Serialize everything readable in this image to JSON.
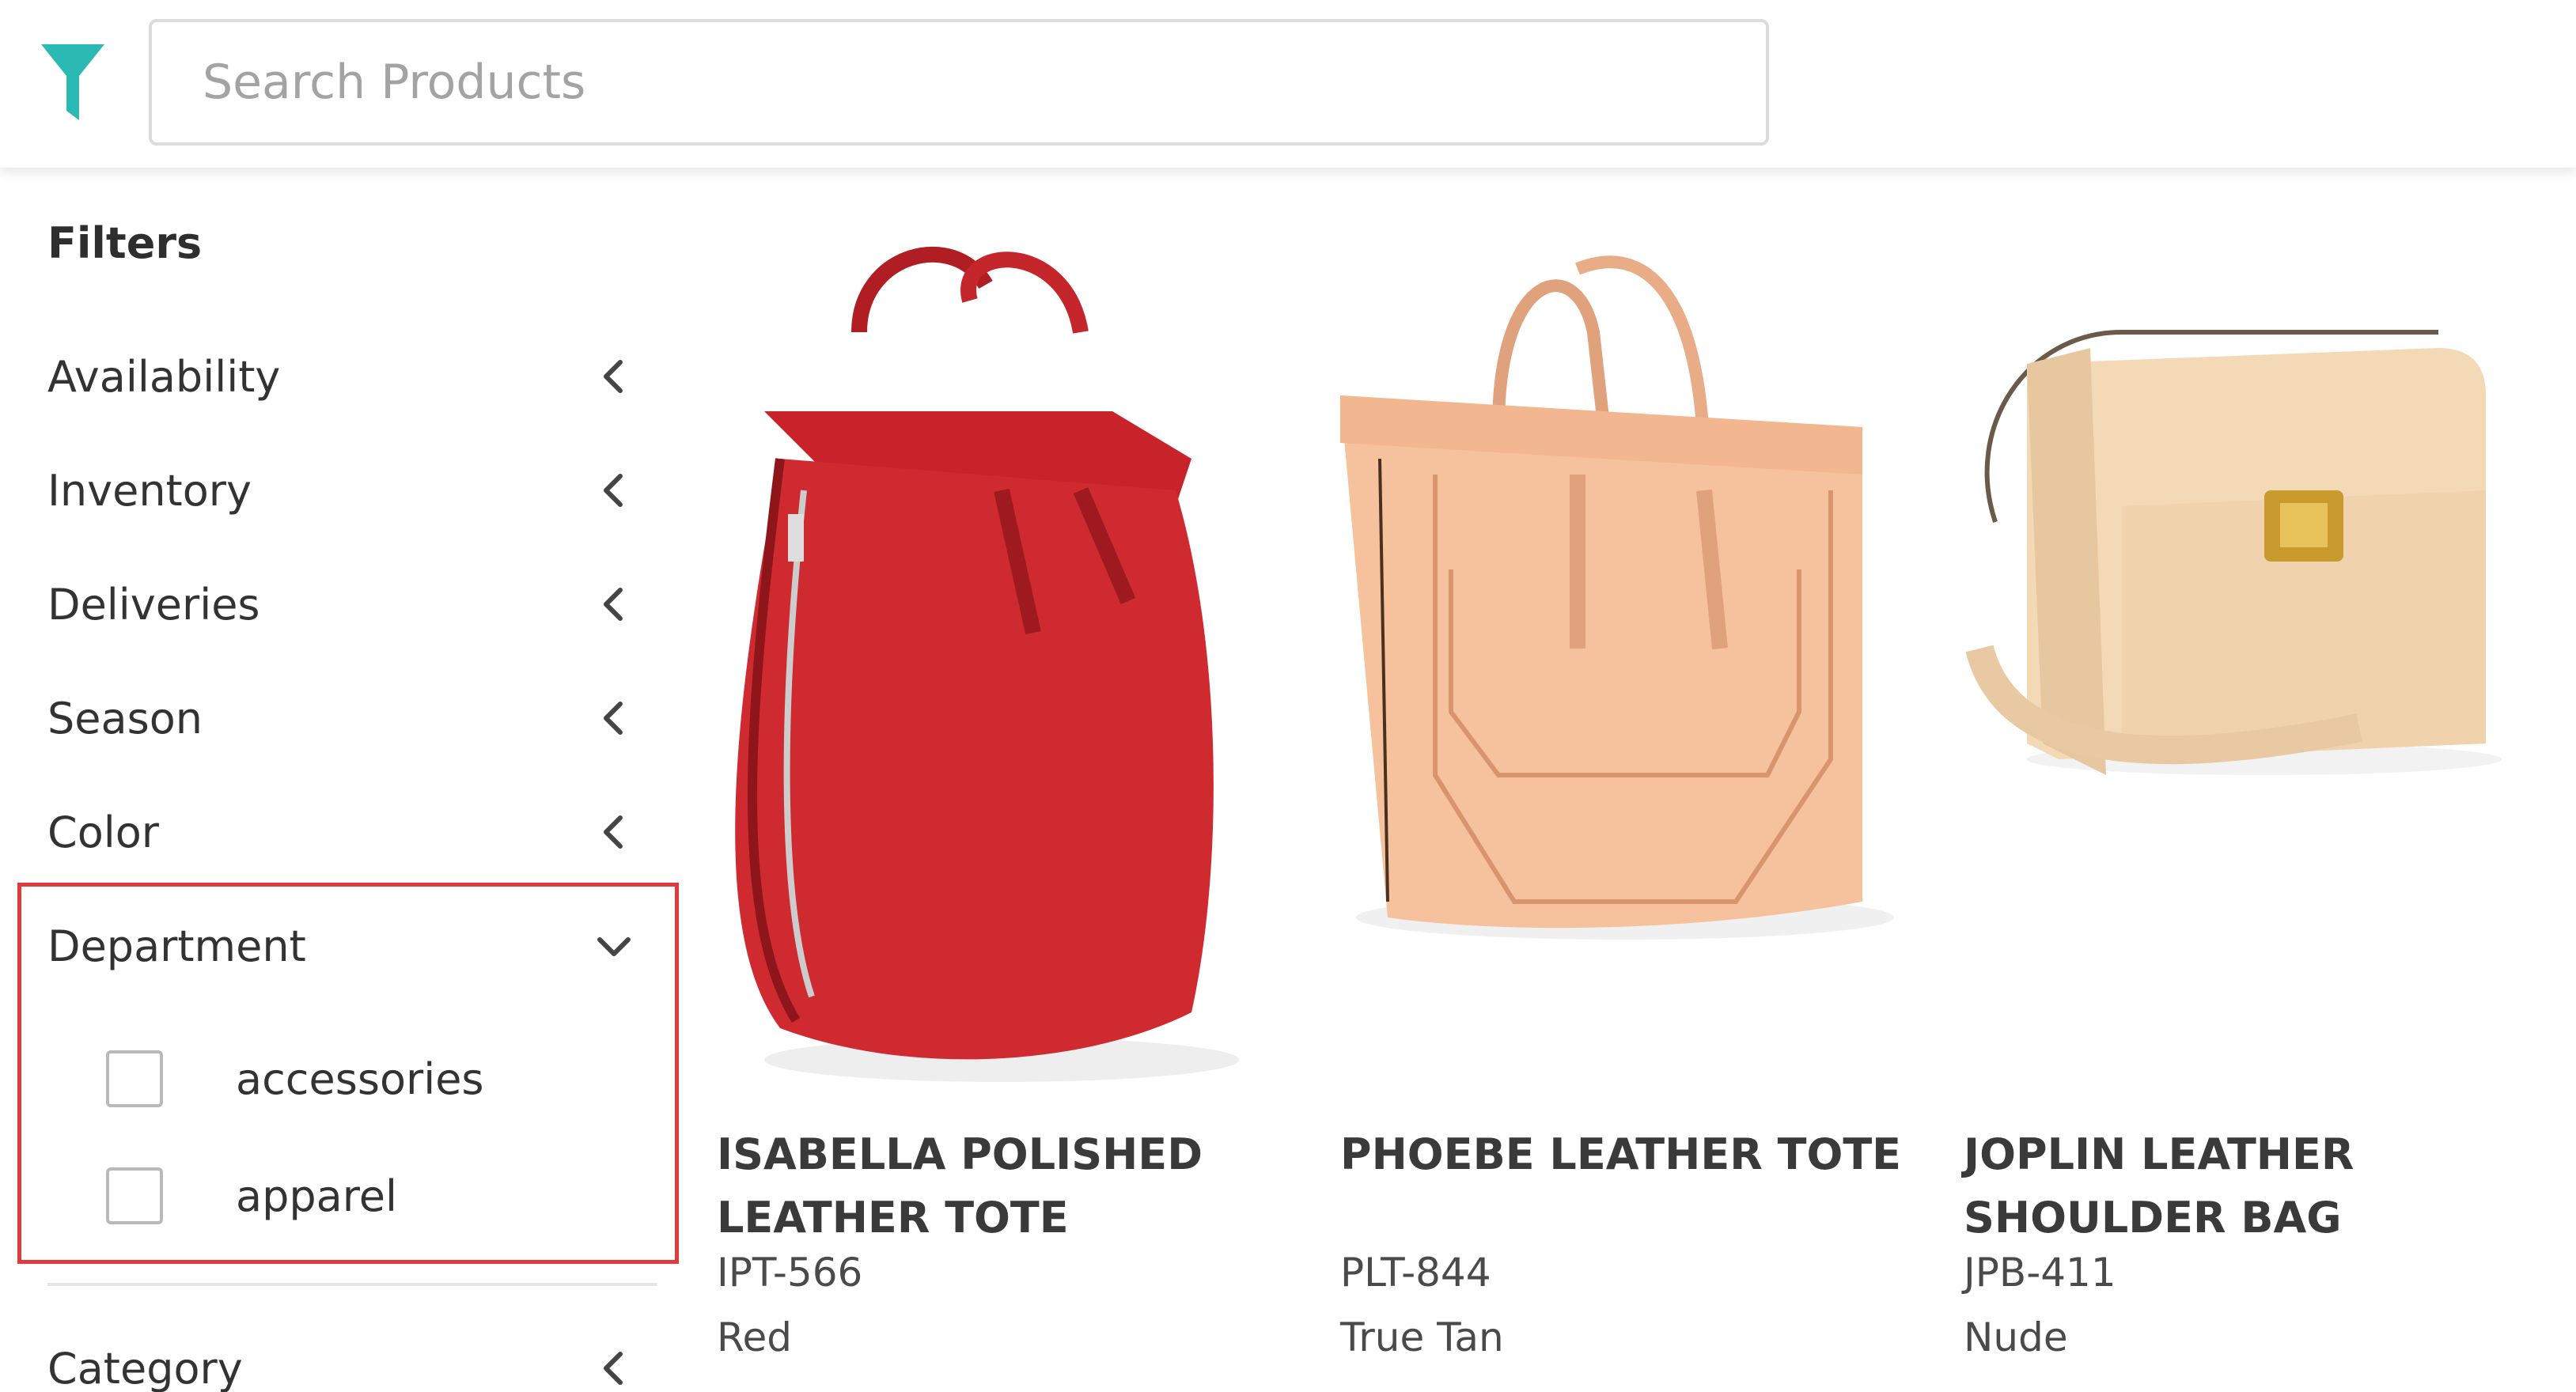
{
  "search": {
    "placeholder": "Search Products"
  },
  "sidebar": {
    "title": "Filters",
    "items": [
      {
        "label": "Availability"
      },
      {
        "label": "Inventory"
      },
      {
        "label": "Deliveries"
      },
      {
        "label": "Season"
      },
      {
        "label": "Color"
      },
      {
        "label": "Department"
      },
      {
        "label": "Category"
      }
    ],
    "department_options": [
      {
        "label": "accessories",
        "checked": false
      },
      {
        "label": "apparel",
        "checked": false
      }
    ]
  },
  "products": [
    {
      "name": "ISABELLA POLISHED LEATHER TOTE",
      "sku": "IPT-566",
      "color": "Red"
    },
    {
      "name": "PHOEBE LEATHER TOTE",
      "sku": "PLT-844",
      "color": "True Tan"
    },
    {
      "name": "JOPLIN LEATHER SHOULDER BAG",
      "sku": "JPB-411",
      "color": "Nude"
    }
  ],
  "colors": {
    "accent": "#2bb9b3",
    "highlight_border": "#e03b3b"
  }
}
